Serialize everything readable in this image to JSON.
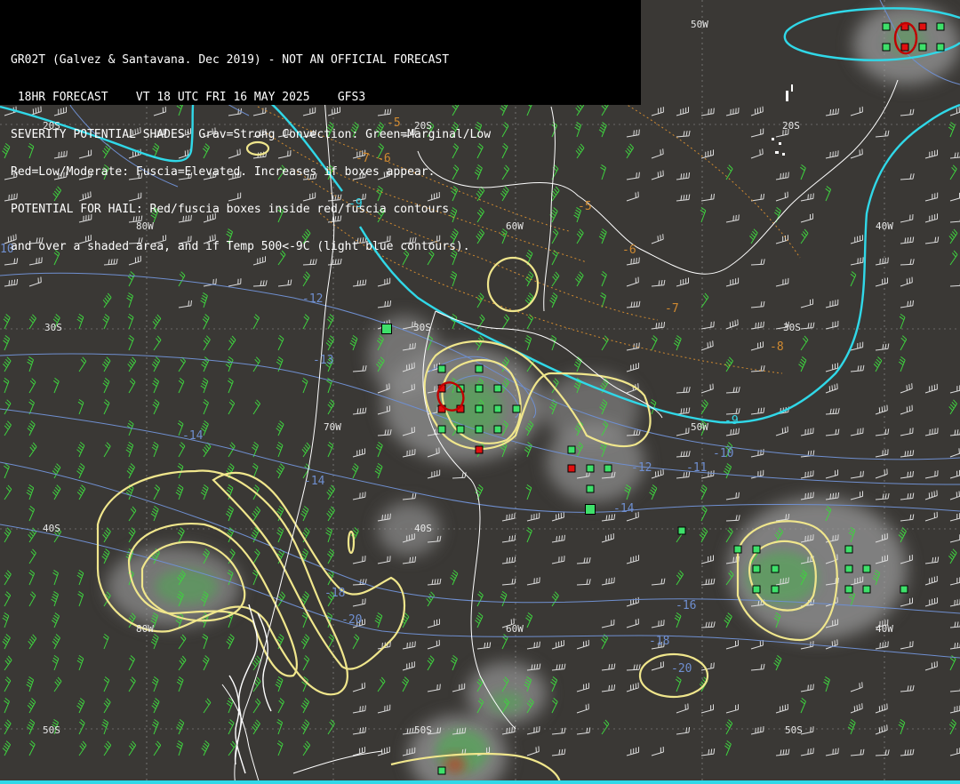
{
  "header": {
    "line1": "GR02T (Galvez & Santavana. Dec 2019) - NOT AN OFFICIAL FORECAST",
    "line2": " 18HR FORECAST    VT 18 UTC FRI 16 MAY 2025    GFS3",
    "line3": "SEVERITY POTENTIAL SHADES: Grav=Strong Convection: Green=Marginal/Low",
    "line4": "Red=Low/Moderate: Fuscia=Elevated. Increases if boxes appear.",
    "line5": "POTENTIAL FOR HAIL: Red/fuscia boxes inside red/fuscia contours",
    "line6": "and over a shaded area, and if Temp 500<-9C (light blue contours)."
  },
  "grid_labels": {
    "lat_20s_a": "20S",
    "lat_20s_b": "20S",
    "lat_20s_c": "20S",
    "lat_30s_a": "30S",
    "lat_30s_b": "30S",
    "lat_30s_c": "30S",
    "lat_40s_a": "40S",
    "lat_40s_b": "40S",
    "lat_50s_a": "50S",
    "lat_50s_b": "50S",
    "lat_50s_c": "50S",
    "lon_80w_a": "80W",
    "lon_80w_b": "80W",
    "lon_70w": "70W",
    "lon_60w_a": "60W",
    "lon_60w_b": "60W",
    "lon_50w_a": "50W",
    "lon_50w_b": "50W",
    "lon_40w_a": "40W",
    "lon_40w_b": "40W"
  },
  "temp_labels": {
    "t_m5_a": "-5",
    "t_m6": "-6",
    "t_m7_a": "-7",
    "t_m5_b": "-5",
    "t_m6_b": "-6",
    "t_m7_b": "-7",
    "t_m8": "-8",
    "t_m9_a": "-9",
    "t_m9_b": "-9",
    "t_m10_a": "10",
    "t_m10_b": "-10",
    "t_m11": "-11",
    "t_m12_a": "-12",
    "t_m12_b": "-12",
    "t_m13": "-13",
    "t_m14_a": "-14",
    "t_m14_b": "-14",
    "t_m14_c": "-14",
    "t_m16": "-16",
    "t_m18_a": "-18",
    "t_m18_b": "-18",
    "t_m20_a": "-20",
    "t_m20_b": "-20"
  },
  "colors": {
    "background": "#3a3835",
    "coast": "#ffffff",
    "minus9_contour": "#30d8e8",
    "temp_contour": "#6f8fd0",
    "warm_contour": "#d08a30",
    "severity_contour": "#f0e68c",
    "convection_gray": "#8c8c8c",
    "convection_green": "#4caf50",
    "convection_red": "#c0392b",
    "box_green": "#3ee06a",
    "box_red": "#e01010",
    "barb_green": "#3fd23f",
    "barb_white": "#dddddd"
  }
}
